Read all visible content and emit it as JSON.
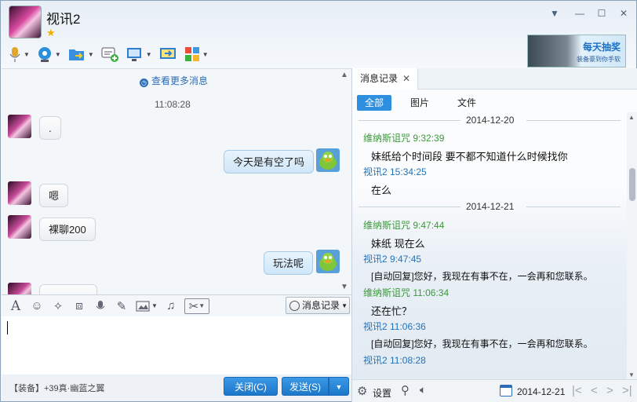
{
  "window": {
    "title": "视讯2",
    "controls": [
      "▼",
      "—",
      "☐",
      "✕"
    ]
  },
  "ad": {
    "title": "每天抽奖",
    "subtitle": "装备豪到你手软"
  },
  "chat": {
    "see_more": "查看更多消息",
    "time": "11:08:28",
    "messages": [
      {
        "from": "other",
        "text": "."
      },
      {
        "from": "me",
        "text": "今天是有空了吗"
      },
      {
        "from": "other",
        "text": "嗯"
      },
      {
        "from": "other",
        "text": "裸聊200"
      },
      {
        "from": "me",
        "text": "玩法呢"
      }
    ]
  },
  "input_toolbar": {
    "history_label": "消息记录"
  },
  "footer": {
    "equip": "【装备】+39真·幽蓝之翼",
    "close": "关闭(C)",
    "send": "发送(S)"
  },
  "history": {
    "tab": "消息记录",
    "filters": [
      "全部",
      "图片",
      "文件"
    ],
    "entries": [
      {
        "type": "date",
        "text": "2014-12-20"
      },
      {
        "type": "who",
        "color": "green",
        "text": "维纳斯诅咒 9:32:39"
      },
      {
        "type": "msg",
        "text": "妹纸给个时间段 要不都不知道什么时候找你"
      },
      {
        "type": "who",
        "color": "blue",
        "text": "视讯2 15:34:25"
      },
      {
        "type": "msg",
        "text": "在么"
      },
      {
        "type": "date",
        "text": "2014-12-21"
      },
      {
        "type": "who",
        "color": "green",
        "text": "维纳斯诅咒 9:47:44"
      },
      {
        "type": "msg",
        "text": "妹纸 现在么"
      },
      {
        "type": "who",
        "color": "blue",
        "text": "视讯2 9:47:45"
      },
      {
        "type": "msg",
        "text": "[自动回复]您好，我现在有事不在，一会再和您联系。"
      },
      {
        "type": "who",
        "color": "green",
        "text": "维纳斯诅咒 11:06:34"
      },
      {
        "type": "msg",
        "text": "还在忙？"
      },
      {
        "type": "who",
        "color": "blue",
        "text": "视讯2 11:06:36"
      },
      {
        "type": "msg",
        "text": "[自动回复]您好，我现在有事不在，一会再和您联系。"
      },
      {
        "type": "who",
        "color": "blue",
        "text": "视讯2 11:08:28"
      }
    ],
    "settings": "设置",
    "date": "2014-12-21"
  },
  "colors": {
    "accent": "#2e8ee0",
    "green_name": "#3a9a3a",
    "blue_name": "#2472b8"
  }
}
